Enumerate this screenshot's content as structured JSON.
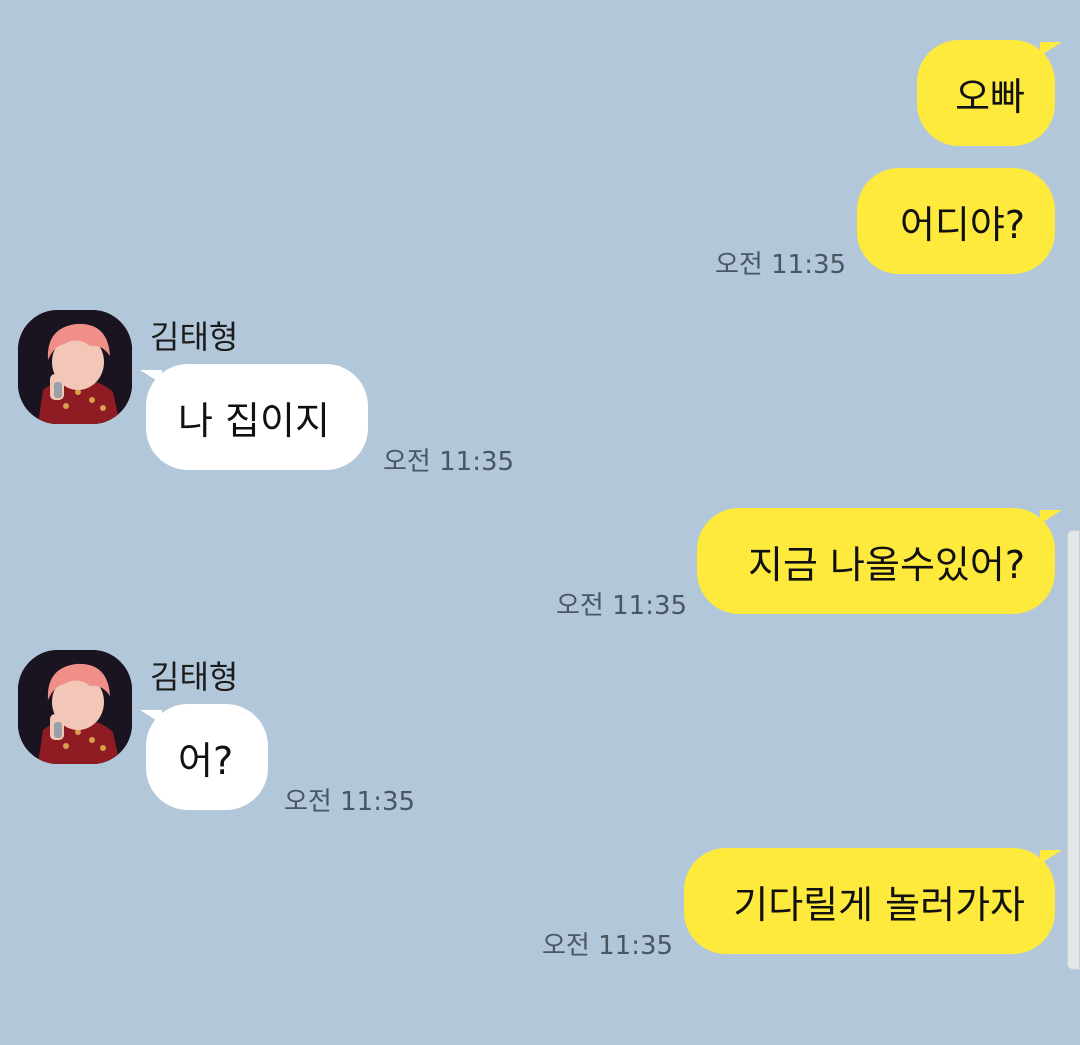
{
  "conversation": {
    "contact_name": "김태형",
    "messages": [
      {
        "sender": "me",
        "text": "오빠"
      },
      {
        "sender": "me",
        "text": "어디야?",
        "time": "오전 11:35"
      },
      {
        "sender": "them",
        "name": "김태형",
        "text": "나 집이지",
        "time": "오전 11:35"
      },
      {
        "sender": "me",
        "text": "지금 나올수있어?",
        "time": "오전 11:35"
      },
      {
        "sender": "them",
        "name": "김태형",
        "text": "어?",
        "time": "오전 11:35"
      },
      {
        "sender": "me",
        "text": "기다릴게 놀러가자",
        "time": "오전 11:35"
      }
    ]
  },
  "colors": {
    "background": "#b2c7d9",
    "my_bubble": "#fee93d",
    "their_bubble": "#ffffff",
    "time_text": "#4a5661"
  }
}
